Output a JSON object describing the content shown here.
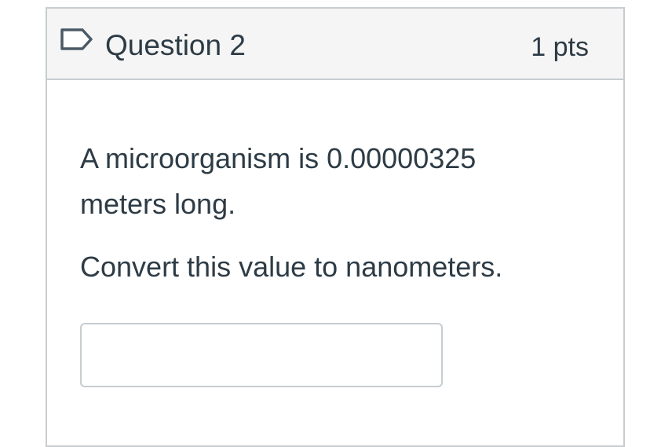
{
  "question": {
    "title": "Question 2",
    "points": "1 pts",
    "text": "A microorganism is 0.00000325 meters long.",
    "instruction": "Convert this value to nanometers.",
    "answer_value": "",
    "answer_placeholder": ""
  },
  "icons": {
    "flag": "flag-outline-icon"
  },
  "colors": {
    "text": "#2d3b45",
    "border": "#c7cdd1",
    "header_background": "#f5f5f5"
  }
}
